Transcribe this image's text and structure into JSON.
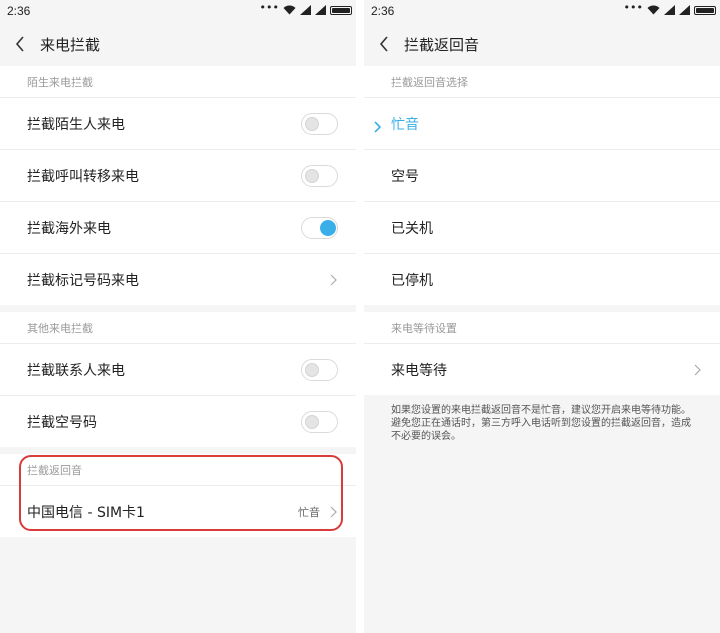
{
  "status": {
    "time": "2:36"
  },
  "left": {
    "title": "来电拦截",
    "sections": [
      {
        "header": "陌生来电拦截",
        "rows": [
          {
            "label": "拦截陌生人来电"
          },
          {
            "label": "拦截呼叫转移来电"
          },
          {
            "label": "拦截海外来电"
          },
          {
            "label": "拦截标记号码来电"
          }
        ]
      },
      {
        "header": "其他来电拦截",
        "rows": [
          {
            "label": "拦截联系人来电"
          },
          {
            "label": "拦截空号码"
          }
        ]
      },
      {
        "header": "拦截返回音",
        "rows": [
          {
            "label": "中国电信 - SIM卡1",
            "value": "忙音"
          }
        ]
      }
    ]
  },
  "right": {
    "title": "拦截返回音",
    "sections": [
      {
        "header": "拦截返回音选择",
        "options": [
          "忙音",
          "空号",
          "已关机",
          "已停机"
        ],
        "selected": "忙音"
      },
      {
        "header": "来电等待设置",
        "rows": [
          {
            "label": "来电等待"
          }
        ]
      }
    ],
    "note": "如果您设置的来电拦截返回音不是忙音，建议您开启来电等待功能。避免您正在通话时，第三方呼入电话听到您设置的拦截返回音，造成不必要的误会。"
  },
  "toggles": {
    "block_strangers": false,
    "block_forwarded": false,
    "block_overseas": true,
    "block_contacts": false,
    "block_empty_numbers": false
  },
  "colors": {
    "accent": "#3aaee8",
    "highlight": "#d93a3a"
  }
}
